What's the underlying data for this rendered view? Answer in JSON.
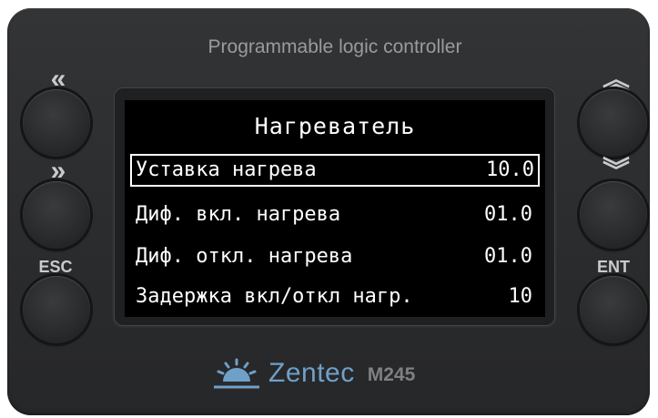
{
  "device": {
    "title": "Programmable logic controller",
    "brand": "Zentec",
    "model": "M245"
  },
  "screen": {
    "title": "Нагреватель",
    "rows": [
      {
        "label": "Уставка нагрева",
        "value": "10.0",
        "selected": true
      },
      {
        "label": "Диф. вкл. нагрева",
        "value": "01.0",
        "selected": false
      },
      {
        "label": "Диф. откл. нагрева",
        "value": "01.0",
        "selected": false
      },
      {
        "label": "Задержка вкл/откл нагр.",
        "value": "10",
        "selected": false
      }
    ]
  },
  "buttons": {
    "left": [
      {
        "label": "«",
        "icon": "double-chevron-left-icon"
      },
      {
        "label": "»",
        "icon": "double-chevron-right-icon"
      },
      {
        "label": "ESC"
      }
    ],
    "right": [
      {
        "label": "︽",
        "icon": "double-chevron-up-icon"
      },
      {
        "label": "︾",
        "icon": "double-chevron-down-icon"
      },
      {
        "label": "ENT"
      }
    ]
  },
  "colors": {
    "body": "#2b2c2e",
    "screen": "#000000",
    "brand": "#6fa0c8"
  }
}
